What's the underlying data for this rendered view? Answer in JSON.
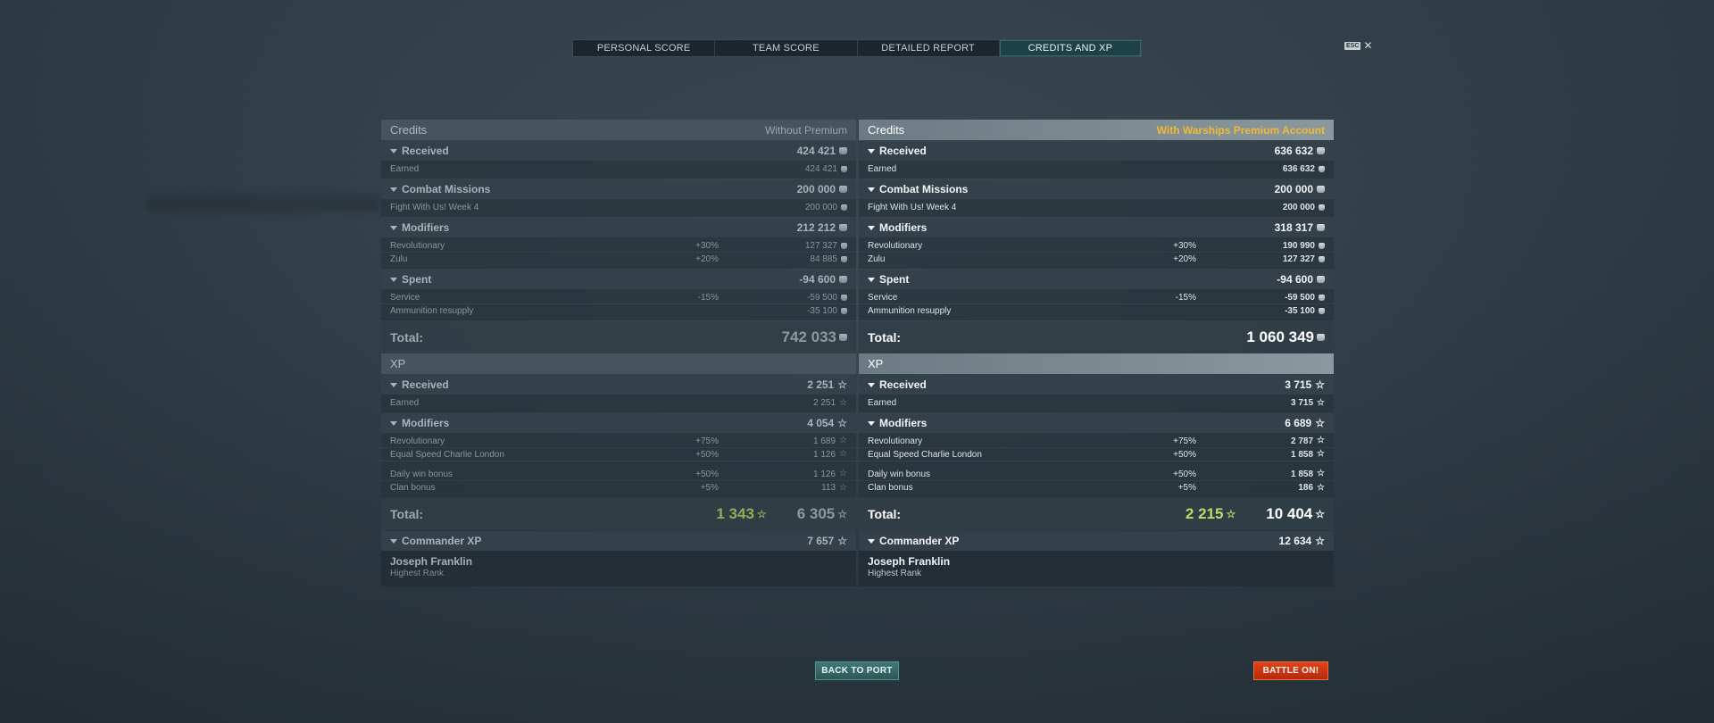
{
  "tabs": [
    "PERSONAL SCORE",
    "TEAM SCORE",
    "DETAILED REPORT",
    "CREDITS AND XP"
  ],
  "active_tab": "CREDITS AND XP",
  "esc": {
    "key": "ESC",
    "close": "✕"
  },
  "left": {
    "credits_title": "Credits",
    "credits_note": "Without Premium",
    "received": {
      "label": "Received",
      "value": "424 421"
    },
    "earned": {
      "label": "Earned",
      "value": "424 421"
    },
    "missions": {
      "label": "Combat Missions",
      "value": "200 000"
    },
    "mission_row": {
      "label": "Fight With Us! Week 4",
      "value": "200 000"
    },
    "modifiers": {
      "label": "Modifiers",
      "value": "212 212"
    },
    "mod_rows": [
      {
        "label": "Revolutionary",
        "pct": "+30%",
        "value": "127 327"
      },
      {
        "label": "Zulu",
        "pct": "+20%",
        "value": "84 885"
      }
    ],
    "spent": {
      "label": "Spent",
      "value": "-94 600"
    },
    "spent_rows": [
      {
        "label": "Service",
        "pct": "-15%",
        "value": "-59 500"
      },
      {
        "label": "Ammunition resupply",
        "pct": "",
        "value": "-35 100"
      }
    ],
    "credits_total": {
      "label": "Total:",
      "value": "742 033"
    },
    "xp_title": "XP",
    "xp_received": {
      "label": "Received",
      "value": "2 251"
    },
    "xp_earned": {
      "label": "Earned",
      "value": "2 251"
    },
    "xp_modifiers": {
      "label": "Modifiers",
      "value": "4 054"
    },
    "xp_mod_rows": [
      {
        "label": "Revolutionary",
        "pct": "+75%",
        "value": "1 689"
      },
      {
        "label": "Equal Speed Charlie London",
        "pct": "+50%",
        "value": "1 126"
      }
    ],
    "xp_bonus_rows": [
      {
        "label": "Daily win bonus",
        "pct": "+50%",
        "value": "1 126"
      },
      {
        "label": "Clan bonus",
        "pct": "+5%",
        "value": "113"
      }
    ],
    "xp_total": {
      "label": "Total:",
      "green": "1 343",
      "value": "6 305"
    },
    "commander": {
      "label": "Commander XP",
      "value": "7 657"
    },
    "commander_name": "Joseph Franklin",
    "commander_rank": "Highest Rank"
  },
  "right": {
    "credits_title": "Credits",
    "credits_note": "With Warships Premium Account",
    "received": {
      "label": "Received",
      "value": "636 632"
    },
    "earned": {
      "label": "Earned",
      "value": "636 632"
    },
    "missions": {
      "label": "Combat Missions",
      "value": "200 000"
    },
    "mission_row": {
      "label": "Fight With Us! Week 4",
      "value": "200 000"
    },
    "modifiers": {
      "label": "Modifiers",
      "value": "318 317"
    },
    "mod_rows": [
      {
        "label": "Revolutionary",
        "pct": "+30%",
        "value": "190 990"
      },
      {
        "label": "Zulu",
        "pct": "+20%",
        "value": "127 327"
      }
    ],
    "spent": {
      "label": "Spent",
      "value": "-94 600"
    },
    "spent_rows": [
      {
        "label": "Service",
        "pct": "-15%",
        "value": "-59 500"
      },
      {
        "label": "Ammunition resupply",
        "pct": "",
        "value": "-35 100"
      }
    ],
    "credits_total": {
      "label": "Total:",
      "value": "1 060 349"
    },
    "xp_title": "XP",
    "xp_received": {
      "label": "Received",
      "value": "3 715"
    },
    "xp_earned": {
      "label": "Earned",
      "value": "3 715"
    },
    "xp_modifiers": {
      "label": "Modifiers",
      "value": "6 689"
    },
    "xp_mod_rows": [
      {
        "label": "Revolutionary",
        "pct": "+75%",
        "value": "2 787"
      },
      {
        "label": "Equal Speed Charlie London",
        "pct": "+50%",
        "value": "1 858"
      }
    ],
    "xp_bonus_rows": [
      {
        "label": "Daily win bonus",
        "pct": "+50%",
        "value": "1 858"
      },
      {
        "label": "Clan bonus",
        "pct": "+5%",
        "value": "186"
      }
    ],
    "xp_total": {
      "label": "Total:",
      "green": "2 215",
      "value": "10 404"
    },
    "commander": {
      "label": "Commander XP",
      "value": "12 634"
    },
    "commander_name": "Joseph Franklin",
    "commander_rank": "Highest Rank"
  },
  "buttons": {
    "back": "BACK TO PORT",
    "battle": "BATTLE ON!"
  }
}
